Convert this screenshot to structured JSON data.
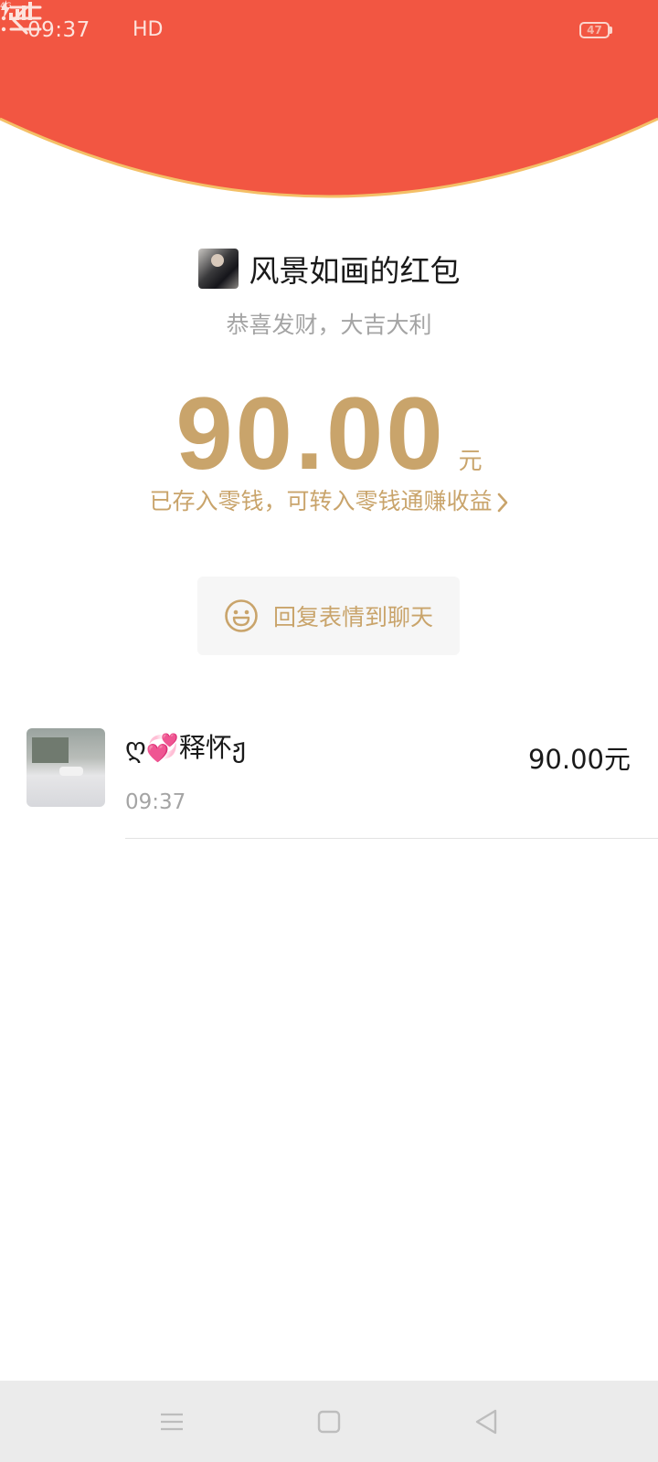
{
  "colors": {
    "header_red": "#f25642",
    "gold": "#c9a46b",
    "curve_stroke": "#f4c067"
  },
  "status_bar": {
    "time": "09:37",
    "network": "4G",
    "hd": "HD",
    "battery": "47"
  },
  "header": {
    "back_icon": "back-chevron-icon",
    "menu_icon": "list-menu-icon"
  },
  "envelope": {
    "sender_name": "风景如画的红包",
    "greeting": "恭喜发财，大吉大利",
    "amount": "90.00",
    "amount_unit": "元",
    "saved_text": "已存入零钱，可转入零钱通赚收益",
    "reply_label": "回复表情到聊天"
  },
  "receivers": [
    {
      "name": "ღ💞释怀ჟ",
      "time": "09:37",
      "amount": "90.00元"
    }
  ],
  "nav_bar": {
    "icons": [
      "menu-icon",
      "home-square-icon",
      "back-triangle-icon"
    ]
  }
}
